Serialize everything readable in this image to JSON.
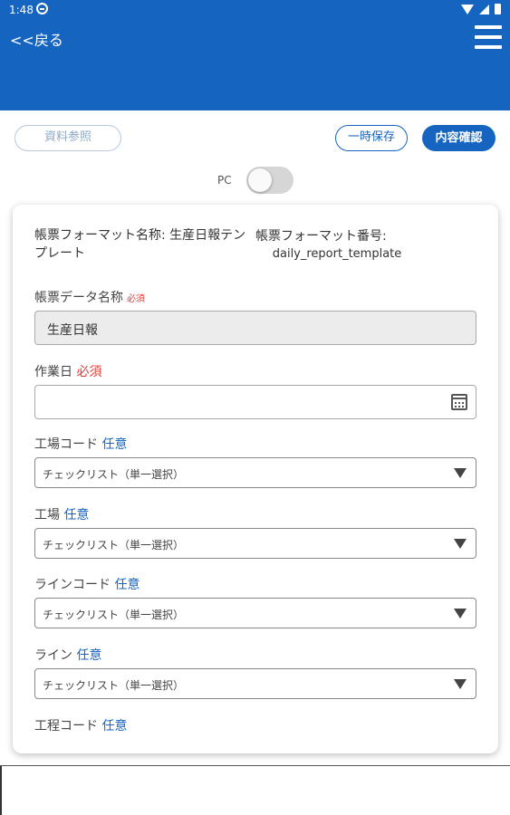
{
  "status_bar": {
    "time": "1:48"
  },
  "header": {
    "back_label": "<<戻る"
  },
  "toolbar": {
    "reference_button": "資料参照",
    "save_button": "一時保存",
    "confirm_button": "内容確認",
    "pc_toggle_label": "PC",
    "pc_toggle_on": false
  },
  "form": {
    "format_name_label": "帳票フォーマット名称: 生産日報テンプレート",
    "format_number_label": "帳票フォーマット番号:",
    "format_number_value": "daily_report_template",
    "fields": [
      {
        "label": "帳票データ名称",
        "badge": "必須",
        "value": "生産日報"
      },
      {
        "label": "作業日",
        "badge": "必須",
        "value": ""
      },
      {
        "label": "工場コード",
        "badge": "任意",
        "value": "チェックリスト（単一選択）"
      },
      {
        "label": "工場",
        "badge": "任意",
        "value": "チェックリスト（単一選択）"
      },
      {
        "label": "ラインコード",
        "badge": "任意",
        "value": "チェックリスト（単一選択）"
      },
      {
        "label": "ライン",
        "badge": "任意",
        "value": "チェックリスト（単一選択）"
      },
      {
        "label": "工程コード",
        "badge": "任意"
      }
    ]
  },
  "colors": {
    "primary": "#1565c0",
    "required": "#e53935",
    "optional": "#1565c0"
  }
}
